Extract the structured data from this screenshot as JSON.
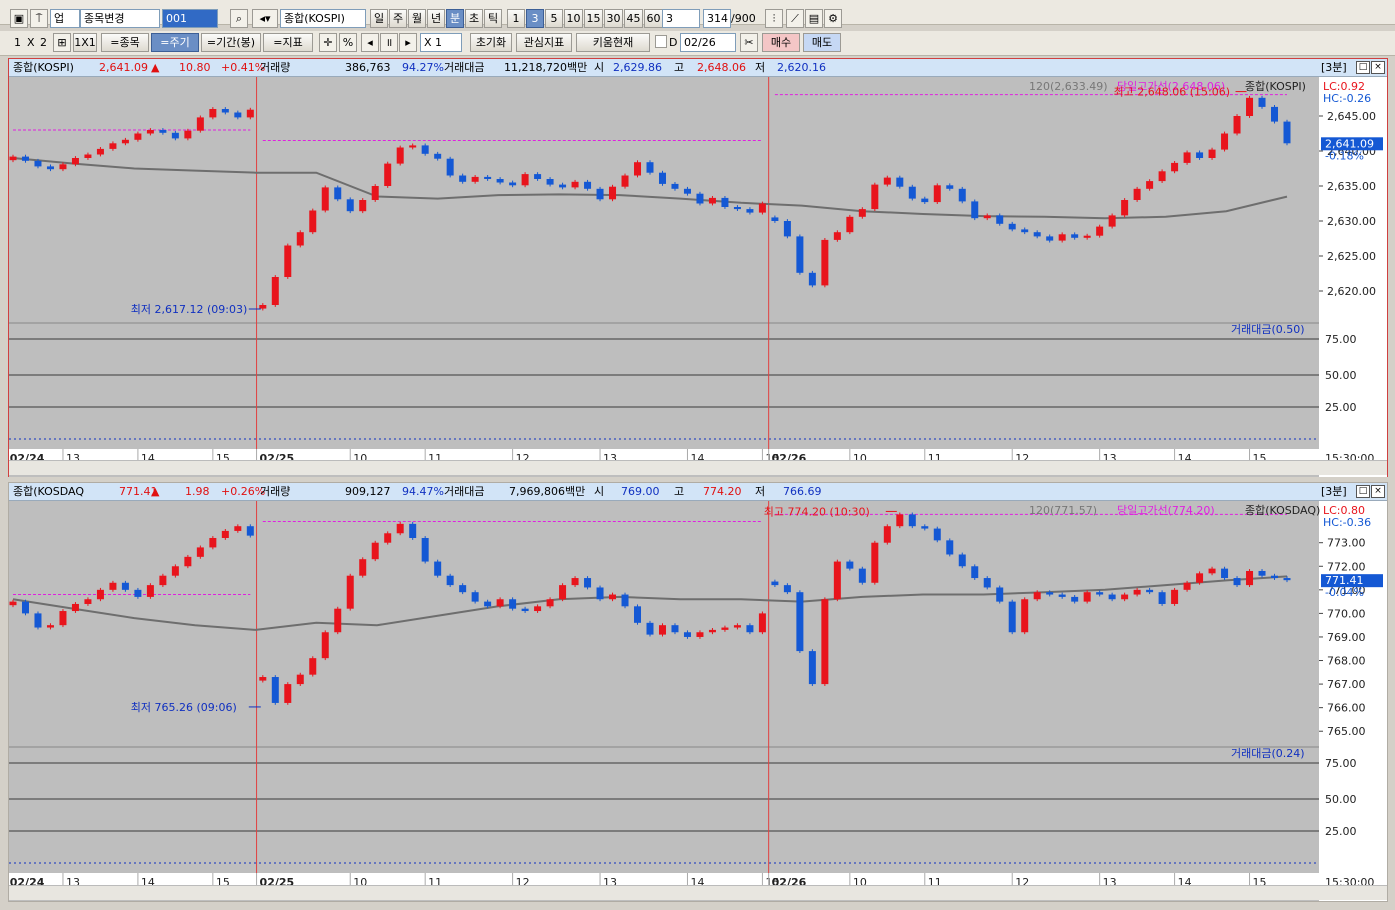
{
  "toolbar1": {
    "category_label": "업",
    "search_dropdown": "종목변경",
    "code_value": "001",
    "name_value": "종합(KOSPI)",
    "period_buttons": [
      "일",
      "주",
      "월",
      "년",
      "분",
      "초",
      "틱"
    ],
    "active_period": "분",
    "interval_buttons": [
      "1",
      "3",
      "5",
      "10",
      "15",
      "30",
      "45",
      "60"
    ],
    "active_interval": "3",
    "interval_select": "3",
    "count_value": "314",
    "count_total": "/900"
  },
  "toolbar2": {
    "layout_labels": [
      "1",
      "X",
      "2"
    ],
    "layout_1x1": "1X1",
    "btn_stock": "=종목",
    "btn_period": "=주기",
    "btn_range": "=기간(봉)",
    "btn_indicator": "=지표",
    "percent_label": "%",
    "multiplier": "X 1",
    "btn_reset": "초기화",
    "btn_interest": "관심지표",
    "btn_kiwoom": "키움현재",
    "date_label": "D",
    "date_value": "02/26",
    "btn_buy": "매수",
    "btn_sell": "매도"
  },
  "panel_kospi": {
    "name": "종합(KOSPI)",
    "price": "2,641.09",
    "arrow": "▲",
    "change": "10.80",
    "change_pct": "+0.41%",
    "vol_label": "거래량",
    "volume": "386,763",
    "vol_ratio": "94.27%",
    "amount_label": "거래대금",
    "amount": "11,218,720백만",
    "open_label": "시",
    "open": "2,629.86",
    "high_label": "고",
    "high": "2,648.06",
    "low_label": "저",
    "low": "2,620.16",
    "period_tag": "[3분]",
    "ma_label": "120(2,633.49)",
    "day_high_label": "당일고가선(2,648.06)",
    "legend_name": "종합(KOSPI)",
    "lc": "LC:0.92",
    "hc": "HC:-0.26",
    "max_note": "최고 2,648.06 (15:06)",
    "min_note": "최저 2,617.12 (09:03)",
    "current_tag": "2,641.09",
    "current_pct": "-0.18%",
    "sub_label": "거래대금(0.50)",
    "time_end": "15:30:00"
  },
  "panel_kosdaq": {
    "name": "종합(KOSDAQ",
    "price": "771.41",
    "arrow": "▲",
    "change": "1.98",
    "change_pct": "+0.26%",
    "vol_label": "거래량",
    "volume": "909,127",
    "vol_ratio": "94.47%",
    "amount_label": "거래대금",
    "amount": "7,969,806백만",
    "open_label": "시",
    "open": "769.00",
    "high_label": "고",
    "high": "774.20",
    "low_label": "저",
    "low": "766.69",
    "period_tag": "[3분]",
    "ma_label": "120(771.57)",
    "day_high_label": "당일고가선(774.20)",
    "legend_name": "종합(KOSDAQ)",
    "lc": "LC:0.80",
    "hc": "HC:-0.36",
    "max_note": "최고 774.20 (10:30)",
    "min_note": "최저 765.26 (09:06)",
    "current_tag": "771.41",
    "current_pct": "-0.04%",
    "sub_label": "거래대금(0.24)",
    "time_end": "15:30:00"
  },
  "x_ticks": [
    "02/24",
    "13",
    "14",
    "15",
    "02/25",
    "10",
    "11",
    "12",
    "13",
    "14",
    "15",
    "02/26",
    "10",
    "11",
    "12",
    "13",
    "14",
    "15"
  ],
  "colors": {
    "up": "#e8141c",
    "down": "#1458d4",
    "ma": "#6e6e6e",
    "dayhigh": "#e020e0",
    "session": "#e04040"
  },
  "chart_data": [
    {
      "type": "line",
      "title": "종합(KOSPI)",
      "description_unit": "3분봉",
      "ylim": [
        2616,
        2650
      ],
      "y_ticks": [
        2620,
        2625,
        2630,
        2635,
        2640,
        2645
      ],
      "sessions": [
        "02/24",
        "02/25",
        "02/26"
      ],
      "close_series": [
        2639.2,
        2638.6,
        2637.8,
        2637.4,
        2638.1,
        2639.0,
        2639.5,
        2640.3,
        2641.1,
        2641.6,
        2642.5,
        2643.0,
        2642.6,
        2641.8,
        2642.9,
        2644.8,
        2646.0,
        2645.5,
        2644.8,
        2645.9,
        2618.0,
        2622.0,
        2626.5,
        2628.4,
        2631.5,
        2634.8,
        2633.1,
        2631.4,
        2633.0,
        2635.0,
        2638.2,
        2640.5,
        2640.8,
        2639.6,
        2638.9,
        2636.5,
        2635.6,
        2636.3,
        2636.0,
        2635.5,
        2635.1,
        2636.7,
        2636.0,
        2635.2,
        2634.8,
        2635.6,
        2634.6,
        2633.1,
        2634.9,
        2636.5,
        2638.4,
        2636.9,
        2635.3,
        2634.6,
        2633.9,
        2632.5,
        2633.3,
        2632.0,
        2631.7,
        2631.2,
        2632.5,
        2630.0,
        2627.8,
        2622.6,
        2620.8,
        2627.3,
        2628.4,
        2630.6,
        2631.7,
        2635.2,
        2636.2,
        2634.9,
        2633.2,
        2632.7,
        2635.1,
        2634.6,
        2632.8,
        2630.4,
        2630.8,
        2629.6,
        2628.8,
        2628.4,
        2627.8,
        2627.2,
        2628.1,
        2627.6,
        2627.9,
        2629.2,
        2630.8,
        2633.0,
        2634.6,
        2635.7,
        2637.1,
        2638.3,
        2639.8,
        2639.0,
        2640.2,
        2642.5,
        2645.0,
        2647.6,
        2646.3,
        2644.2,
        2641.1
      ],
      "ma120": [
        2639,
        2638.2,
        2637.5,
        2637.2,
        2636.9,
        2636.9,
        2633.5,
        2633.2,
        2633.7,
        2633.8,
        2633.7,
        2633.2,
        2632.6,
        2632.2,
        2631.4,
        2631.0,
        2630.7,
        2630.6,
        2630.4,
        2630.6,
        2631.4,
        2633.49
      ],
      "day_high": [
        2643.0,
        2641.5,
        2648.06
      ]
    },
    {
      "type": "line",
      "title": "종합(KOSDAQ)",
      "description_unit": "3분봉",
      "ylim": [
        764.5,
        774.6
      ],
      "y_ticks": [
        765,
        766,
        767,
        768,
        769,
        770,
        771,
        772,
        773
      ],
      "sessions": [
        "02/24",
        "02/25",
        "02/26"
      ],
      "close_series": [
        770.5,
        770.0,
        769.4,
        769.5,
        770.1,
        770.4,
        770.6,
        771.0,
        771.3,
        771.0,
        770.7,
        771.2,
        771.6,
        772.0,
        772.4,
        772.8,
        773.2,
        773.5,
        773.7,
        773.3,
        767.3,
        766.2,
        767.0,
        767.4,
        768.1,
        769.2,
        770.2,
        771.6,
        772.3,
        773.0,
        773.4,
        773.8,
        773.2,
        772.2,
        771.6,
        771.2,
        770.9,
        770.5,
        770.3,
        770.6,
        770.2,
        770.1,
        770.3,
        770.6,
        771.2,
        771.5,
        771.1,
        770.6,
        770.8,
        770.3,
        769.6,
        769.1,
        769.5,
        769.2,
        769.0,
        769.2,
        769.3,
        769.4,
        769.5,
        769.2,
        770.0,
        771.2,
        770.9,
        768.4,
        767.0,
        770.6,
        772.2,
        771.9,
        771.3,
        773.0,
        773.7,
        774.2,
        773.7,
        773.6,
        773.1,
        772.5,
        772.0,
        771.5,
        771.1,
        770.5,
        769.2,
        770.6,
        770.9,
        770.8,
        770.7,
        770.5,
        770.9,
        770.8,
        770.6,
        770.8,
        771.0,
        770.9,
        770.4,
        771.0,
        771.3,
        771.7,
        771.9,
        771.5,
        771.2,
        771.8,
        771.6,
        771.5,
        771.41
      ],
      "ma120": [
        770.6,
        770.2,
        769.8,
        769.5,
        769.3,
        769.6,
        769.5,
        769.9,
        770.3,
        770.6,
        770.7,
        770.6,
        770.6,
        770.5,
        770.7,
        770.8,
        770.8,
        770.9,
        771.0,
        771.2,
        771.4,
        771.57
      ],
      "day_high": [
        770.8,
        773.9,
        774.2
      ]
    }
  ],
  "sub_y_ticks": [
    "75.00",
    "50.00",
    "25.00"
  ]
}
